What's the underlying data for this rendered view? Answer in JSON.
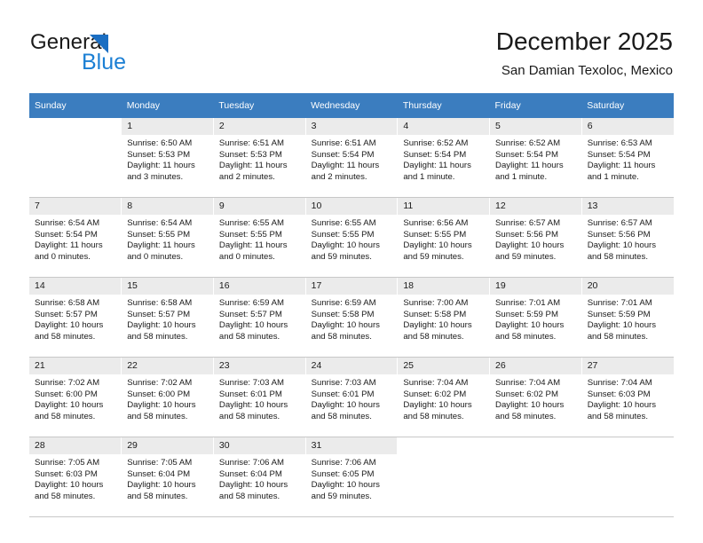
{
  "logo": {
    "word_dark": "General",
    "word_blue": "Blue",
    "triangle_color": "#1b6ec2",
    "blue_color": "#1b7fd4"
  },
  "header": {
    "title": "December 2025",
    "subtitle": "San Damian Texoloc, Mexico",
    "header_bg": "#3b7dbf",
    "daynum_bg": "#ebebeb"
  },
  "weekday_headers": [
    "Sunday",
    "Monday",
    "Tuesday",
    "Wednesday",
    "Thursday",
    "Friday",
    "Saturday"
  ],
  "weeks": [
    [
      {
        "day": "",
        "lines": []
      },
      {
        "day": "1",
        "lines": [
          "Sunrise: 6:50 AM",
          "Sunset: 5:53 PM",
          "Daylight: 11 hours",
          "and 3 minutes."
        ]
      },
      {
        "day": "2",
        "lines": [
          "Sunrise: 6:51 AM",
          "Sunset: 5:53 PM",
          "Daylight: 11 hours",
          "and 2 minutes."
        ]
      },
      {
        "day": "3",
        "lines": [
          "Sunrise: 6:51 AM",
          "Sunset: 5:54 PM",
          "Daylight: 11 hours",
          "and 2 minutes."
        ]
      },
      {
        "day": "4",
        "lines": [
          "Sunrise: 6:52 AM",
          "Sunset: 5:54 PM",
          "Daylight: 11 hours",
          "and 1 minute."
        ]
      },
      {
        "day": "5",
        "lines": [
          "Sunrise: 6:52 AM",
          "Sunset: 5:54 PM",
          "Daylight: 11 hours",
          "and 1 minute."
        ]
      },
      {
        "day": "6",
        "lines": [
          "Sunrise: 6:53 AM",
          "Sunset: 5:54 PM",
          "Daylight: 11 hours",
          "and 1 minute."
        ]
      }
    ],
    [
      {
        "day": "7",
        "lines": [
          "Sunrise: 6:54 AM",
          "Sunset: 5:54 PM",
          "Daylight: 11 hours",
          "and 0 minutes."
        ]
      },
      {
        "day": "8",
        "lines": [
          "Sunrise: 6:54 AM",
          "Sunset: 5:55 PM",
          "Daylight: 11 hours",
          "and 0 minutes."
        ]
      },
      {
        "day": "9",
        "lines": [
          "Sunrise: 6:55 AM",
          "Sunset: 5:55 PM",
          "Daylight: 11 hours",
          "and 0 minutes."
        ]
      },
      {
        "day": "10",
        "lines": [
          "Sunrise: 6:55 AM",
          "Sunset: 5:55 PM",
          "Daylight: 10 hours",
          "and 59 minutes."
        ]
      },
      {
        "day": "11",
        "lines": [
          "Sunrise: 6:56 AM",
          "Sunset: 5:55 PM",
          "Daylight: 10 hours",
          "and 59 minutes."
        ]
      },
      {
        "day": "12",
        "lines": [
          "Sunrise: 6:57 AM",
          "Sunset: 5:56 PM",
          "Daylight: 10 hours",
          "and 59 minutes."
        ]
      },
      {
        "day": "13",
        "lines": [
          "Sunrise: 6:57 AM",
          "Sunset: 5:56 PM",
          "Daylight: 10 hours",
          "and 58 minutes."
        ]
      }
    ],
    [
      {
        "day": "14",
        "lines": [
          "Sunrise: 6:58 AM",
          "Sunset: 5:57 PM",
          "Daylight: 10 hours",
          "and 58 minutes."
        ]
      },
      {
        "day": "15",
        "lines": [
          "Sunrise: 6:58 AM",
          "Sunset: 5:57 PM",
          "Daylight: 10 hours",
          "and 58 minutes."
        ]
      },
      {
        "day": "16",
        "lines": [
          "Sunrise: 6:59 AM",
          "Sunset: 5:57 PM",
          "Daylight: 10 hours",
          "and 58 minutes."
        ]
      },
      {
        "day": "17",
        "lines": [
          "Sunrise: 6:59 AM",
          "Sunset: 5:58 PM",
          "Daylight: 10 hours",
          "and 58 minutes."
        ]
      },
      {
        "day": "18",
        "lines": [
          "Sunrise: 7:00 AM",
          "Sunset: 5:58 PM",
          "Daylight: 10 hours",
          "and 58 minutes."
        ]
      },
      {
        "day": "19",
        "lines": [
          "Sunrise: 7:01 AM",
          "Sunset: 5:59 PM",
          "Daylight: 10 hours",
          "and 58 minutes."
        ]
      },
      {
        "day": "20",
        "lines": [
          "Sunrise: 7:01 AM",
          "Sunset: 5:59 PM",
          "Daylight: 10 hours",
          "and 58 minutes."
        ]
      }
    ],
    [
      {
        "day": "21",
        "lines": [
          "Sunrise: 7:02 AM",
          "Sunset: 6:00 PM",
          "Daylight: 10 hours",
          "and 58 minutes."
        ]
      },
      {
        "day": "22",
        "lines": [
          "Sunrise: 7:02 AM",
          "Sunset: 6:00 PM",
          "Daylight: 10 hours",
          "and 58 minutes."
        ]
      },
      {
        "day": "23",
        "lines": [
          "Sunrise: 7:03 AM",
          "Sunset: 6:01 PM",
          "Daylight: 10 hours",
          "and 58 minutes."
        ]
      },
      {
        "day": "24",
        "lines": [
          "Sunrise: 7:03 AM",
          "Sunset: 6:01 PM",
          "Daylight: 10 hours",
          "and 58 minutes."
        ]
      },
      {
        "day": "25",
        "lines": [
          "Sunrise: 7:04 AM",
          "Sunset: 6:02 PM",
          "Daylight: 10 hours",
          "and 58 minutes."
        ]
      },
      {
        "day": "26",
        "lines": [
          "Sunrise: 7:04 AM",
          "Sunset: 6:02 PM",
          "Daylight: 10 hours",
          "and 58 minutes."
        ]
      },
      {
        "day": "27",
        "lines": [
          "Sunrise: 7:04 AM",
          "Sunset: 6:03 PM",
          "Daylight: 10 hours",
          "and 58 minutes."
        ]
      }
    ],
    [
      {
        "day": "28",
        "lines": [
          "Sunrise: 7:05 AM",
          "Sunset: 6:03 PM",
          "Daylight: 10 hours",
          "and 58 minutes."
        ]
      },
      {
        "day": "29",
        "lines": [
          "Sunrise: 7:05 AM",
          "Sunset: 6:04 PM",
          "Daylight: 10 hours",
          "and 58 minutes."
        ]
      },
      {
        "day": "30",
        "lines": [
          "Sunrise: 7:06 AM",
          "Sunset: 6:04 PM",
          "Daylight: 10 hours",
          "and 58 minutes."
        ]
      },
      {
        "day": "31",
        "lines": [
          "Sunrise: 7:06 AM",
          "Sunset: 6:05 PM",
          "Daylight: 10 hours",
          "and 59 minutes."
        ]
      },
      {
        "day": "",
        "lines": []
      },
      {
        "day": "",
        "lines": []
      },
      {
        "day": "",
        "lines": []
      }
    ]
  ]
}
